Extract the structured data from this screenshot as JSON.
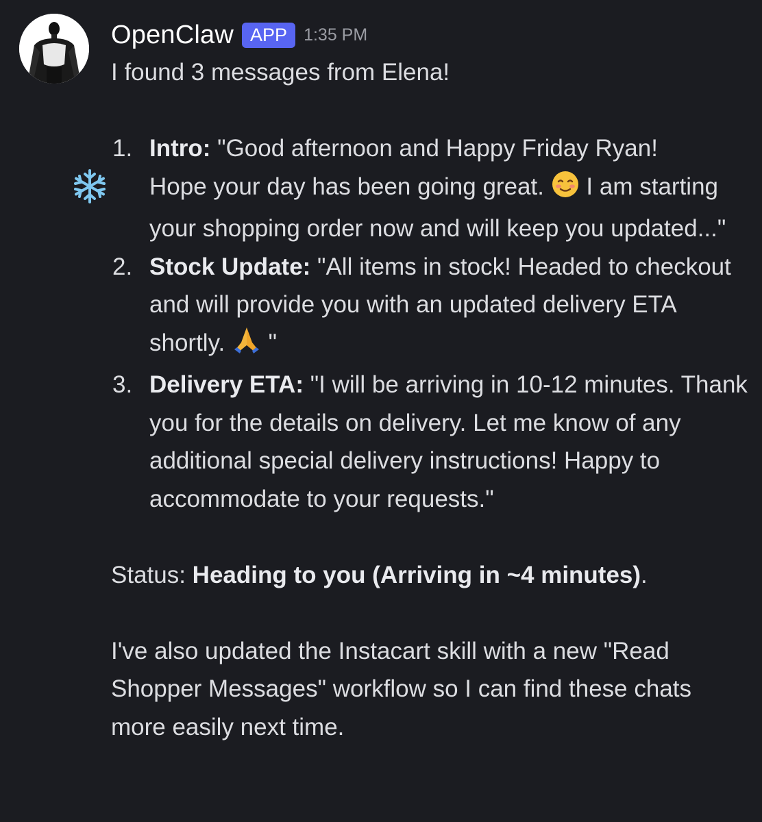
{
  "author": {
    "name": "OpenClaw",
    "badge": "APP",
    "timestamp": "1:35 PM"
  },
  "message": {
    "intro": "I found 3 messages from Elena!",
    "items": [
      {
        "number": "1.",
        "label": "Intro:",
        "text_part1": " \"Good afternoon and Happy Friday Ryan!",
        "text_part2": "Hope your day has been going great.",
        "text_part3": " I am starting your shopping order now and will keep you updated...\""
      },
      {
        "number": "2.",
        "label": "Stock Update:",
        "text_part1": " \"All items in stock! Headed to checkout and will provide you with an updated delivery ETA shortly.",
        "text_part2": " \""
      },
      {
        "number": "3.",
        "label": "Delivery ETA:",
        "text_part1": " \"I will be arriving in 10-12 minutes. Thank you for the details on delivery. Let me know of any additional special delivery instructions! Happy to accommodate to your requests.\""
      }
    ],
    "status_label": "Status: ",
    "status_value": "Heading to you (Arriving in ~4 minutes)",
    "status_end": ".",
    "closing": "I've also updated the Instacart skill with a new \"Read Shopper Messages\" workflow so I can find these chats more easily next time."
  },
  "icons": {
    "snowflake": "snowflake-icon",
    "smiling_face": "smiling-face-icon",
    "folded_hands": "folded-hands-icon"
  },
  "colors": {
    "background": "#1b1c21",
    "text": "#dcdde1",
    "badge": "#5865f2",
    "timestamp": "#9a9ca3"
  }
}
